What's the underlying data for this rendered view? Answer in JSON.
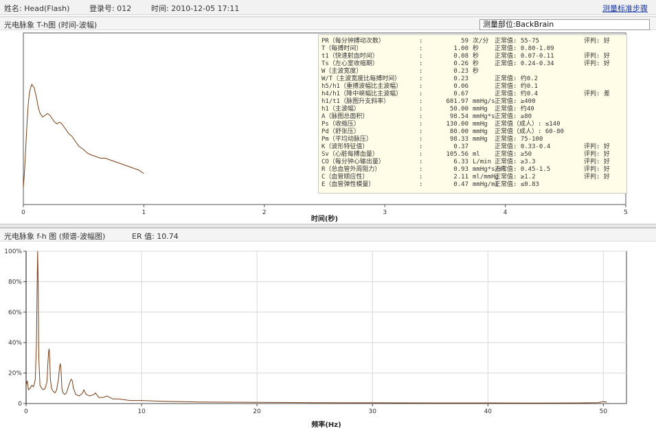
{
  "header": {
    "name_label": "姓名: Head(Flash)",
    "login_label": "登录号: 012",
    "time_label": "时间: 2010-12-05 17:11",
    "steps_link": "测量标准步骤"
  },
  "top_panel": {
    "title": "光电脉象 T-h图 (时间-波幅)",
    "position_box": "测量部位:BackBrain"
  },
  "bottom_panel": {
    "title": "光电脉象 f-h 图 (频谱-波幅图)",
    "er_label": "ER 值: 10.74"
  },
  "metrics": [
    {
      "name": "PR（每分钟搏动次数）",
      "value": "59",
      "unit": "次/分",
      "normal": "正常值: 55-75",
      "judge": "评判: 好"
    },
    {
      "name": "T（每搏时间）",
      "value": "1.00",
      "unit": "秒",
      "normal": "正常值: 0.80-1.09",
      "judge": ""
    },
    {
      "name": "t1（快速射血时间）",
      "value": "0.08",
      "unit": "秒",
      "normal": "正常值: 0.07-0.11",
      "judge": "评判: 好"
    },
    {
      "name": "Ts（左心室收缩期）",
      "value": "0.26",
      "unit": "秒",
      "normal": "正常值: 0.24-0.34",
      "judge": "评判: 好"
    },
    {
      "name": "W（主波宽度）",
      "value": "0.23",
      "unit": "秒",
      "normal": "",
      "judge": ""
    },
    {
      "name": "W/T（主波宽度比每搏时间）",
      "value": "0.23",
      "unit": "",
      "normal": "正常值: 约0.2",
      "judge": ""
    },
    {
      "name": "h5/h1（重搏波幅比主波幅）",
      "value": "0.06",
      "unit": "",
      "normal": "正常值: 约0.1",
      "judge": ""
    },
    {
      "name": "h4/h1（降中峡幅比主波幅）",
      "value": "0.67",
      "unit": "",
      "normal": "正常值: 约0.4",
      "judge": "评判: 差"
    },
    {
      "name": "h1/t1（脉图升支斜率）",
      "value": "601.97",
      "unit": "mmHg/s",
      "normal": "正常值: ≥400",
      "judge": ""
    },
    {
      "name": "h1（主波幅）",
      "value": "50.00",
      "unit": "mmHg",
      "normal": "正常值: 约40",
      "judge": ""
    },
    {
      "name": "A（脉图总面积）",
      "value": "98.54",
      "unit": "mmHg*s",
      "normal": "正常值: ≥80",
      "judge": ""
    },
    {
      "name": "Ps（收缩压）",
      "value": "130.00",
      "unit": "mmHg",
      "normal": "正常值（成人）: ≤140",
      "judge": ""
    },
    {
      "name": "Pd（舒张压）",
      "value": "80.00",
      "unit": "mmHg",
      "normal": "正常值（成人）: 60-80",
      "judge": ""
    },
    {
      "name": "Pm（平均动脉压）",
      "value": "98.33",
      "unit": "mmHg",
      "normal": "正常值: 75-100",
      "judge": ""
    },
    {
      "name": "K（波形特征值）",
      "value": "0.37",
      "unit": "",
      "normal": "正常值: 0.33-0.4",
      "judge": "评判: 好"
    },
    {
      "name": "Sv（心脏每搏血量）",
      "value": "105.56",
      "unit": "ml",
      "normal": "正常值: ≥50",
      "judge": "评判: 好"
    },
    {
      "name": "CO（每分钟心输出量）",
      "value": "6.33",
      "unit": "L/min",
      "normal": "正常值: ≥3.3",
      "judge": "评判: 好"
    },
    {
      "name": "R（总血管外周阻力）",
      "value": "0.93",
      "unit": "mmHg*s/ml",
      "normal": "正常值: 0.45-1.5",
      "judge": "评判: 好"
    },
    {
      "name": "C（血管顺应性）",
      "value": "2.11",
      "unit": "ml/mmHg",
      "normal": "正常值: ≥1.2",
      "judge": "评判: 好"
    },
    {
      "name": "E（血管弹性模量）",
      "value": "0.47",
      "unit": "mmHg/ml",
      "normal": "正常值: ≤0.83",
      "judge": ""
    }
  ],
  "chart_data": [
    {
      "type": "line",
      "xlabel": "时间(秒)",
      "ylabel": "",
      "xlim": [
        0,
        5
      ],
      "ylim": [
        0,
        1
      ],
      "xticks": [
        0,
        1,
        2,
        3,
        4,
        5
      ],
      "grid": false,
      "color": "#7a3a12",
      "series": [
        {
          "x": [
            0,
            0.01,
            0.02,
            0.03,
            0.04,
            0.05,
            0.06,
            0.07,
            0.08,
            0.09,
            0.1,
            0.11,
            0.12,
            0.13,
            0.14,
            0.15,
            0.16,
            0.18,
            0.2,
            0.22,
            0.24,
            0.26,
            0.28,
            0.3,
            0.32,
            0.34,
            0.36,
            0.38,
            0.4,
            0.42,
            0.44,
            0.46,
            0.48,
            0.5,
            0.53,
            0.56,
            0.6,
            0.64,
            0.68,
            0.72,
            0.76,
            0.8,
            0.84,
            0.88,
            0.92,
            0.96,
            1.0
          ],
          "y": [
            0.1,
            0.2,
            0.33,
            0.47,
            0.58,
            0.65,
            0.68,
            0.7,
            0.69,
            0.68,
            0.65,
            0.62,
            0.58,
            0.55,
            0.53,
            0.52,
            0.51,
            0.52,
            0.53,
            0.52,
            0.5,
            0.48,
            0.47,
            0.48,
            0.47,
            0.45,
            0.43,
            0.41,
            0.4,
            0.38,
            0.36,
            0.34,
            0.33,
            0.32,
            0.3,
            0.29,
            0.28,
            0.27,
            0.27,
            0.26,
            0.25,
            0.24,
            0.23,
            0.22,
            0.21,
            0.2,
            0.18
          ]
        }
      ]
    },
    {
      "type": "line",
      "xlabel": "频率(Hz)",
      "ylabel": "",
      "xlim": [
        0,
        52
      ],
      "ylim": [
        0,
        100
      ],
      "xticks": [
        0,
        10,
        20,
        30,
        40,
        50
      ],
      "yticks": [
        0,
        20,
        40,
        60,
        80,
        100
      ],
      "ytick_labels": [
        "0",
        "20%",
        "40%",
        "60%",
        "80%",
        "100%"
      ],
      "grid": true,
      "color": "#7a3a12",
      "series": [
        {
          "x": [
            0,
            0.1,
            0.2,
            0.35,
            0.5,
            0.65,
            0.8,
            0.9,
            0.95,
            1.0,
            1.05,
            1.1,
            1.2,
            1.35,
            1.5,
            1.65,
            1.8,
            1.9,
            1.95,
            2.0,
            2.05,
            2.1,
            2.2,
            2.35,
            2.5,
            2.65,
            2.8,
            2.9,
            2.95,
            3.0,
            3.05,
            3.1,
            3.2,
            3.35,
            3.5,
            3.7,
            3.9,
            4.0,
            4.1,
            4.3,
            4.6,
            4.9,
            5.0,
            5.2,
            5.5,
            5.9,
            6.0,
            6.3,
            6.7,
            7.0,
            7.5,
            8.0,
            9.0,
            10.0,
            12.0,
            15.0,
            20.0,
            25.0,
            30.0,
            35.0,
            40.0,
            45.0,
            48.0,
            49.5,
            50.0,
            50.3
          ],
          "y": [
            12,
            15,
            9,
            10,
            12,
            11,
            16,
            40,
            75,
            100,
            78,
            30,
            12,
            10,
            9,
            10,
            14,
            28,
            34,
            36,
            28,
            16,
            10,
            8,
            7,
            9,
            16,
            24,
            26,
            25,
            18,
            10,
            7,
            6,
            7,
            12,
            16,
            15,
            10,
            6,
            5,
            7,
            9,
            6,
            5,
            6,
            7,
            4,
            4,
            5,
            3,
            3,
            2,
            2,
            1.5,
            1,
            0.8,
            0.6,
            0.5,
            0.4,
            0.4,
            0.3,
            0.4,
            0.6,
            1.2,
            1.0
          ]
        }
      ]
    }
  ]
}
